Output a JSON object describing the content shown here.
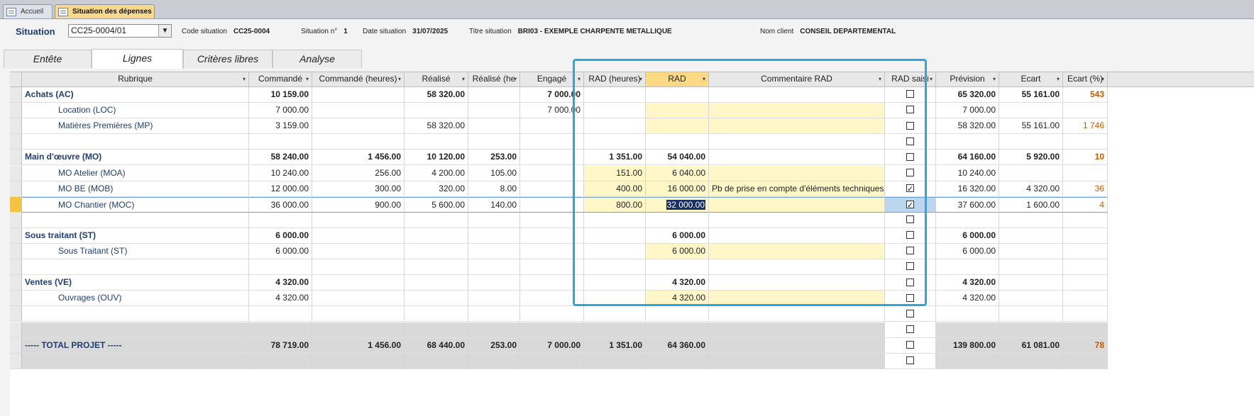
{
  "doc_tabs": [
    {
      "label": "Accueil",
      "active": false
    },
    {
      "label": "Situation des dépenses",
      "active": true
    }
  ],
  "header": {
    "situation_label": "Situation",
    "situation_value": "CC25-0004/01",
    "code_label": "Code situation",
    "code_value": "CC25-0004",
    "num_label": "Situation n°",
    "num_value": "1",
    "date_label": "Date situation",
    "date_value": "31/07/2025",
    "titre_label": "Titre situation",
    "titre_value": "BRI03 - EXEMPLE CHARPENTE METALLIQUE",
    "client_label": "Nom client",
    "client_value": "CONSEIL DEPARTEMENTAL"
  },
  "tabs": [
    {
      "label": "Entête",
      "active": false
    },
    {
      "label": "Lignes",
      "active": true
    },
    {
      "label": "Critères libres",
      "active": false
    },
    {
      "label": "Analyse",
      "active": false
    }
  ],
  "columns": [
    "Rubrique",
    "Commandé",
    "Commandé (heures)",
    "Réalisé",
    "Réalisé (he",
    "Engagé",
    "RAD (heures)",
    "RAD",
    "Commentaire RAD",
    "RAD saisi",
    "Prévision",
    "Ecart",
    "Ecart (%)"
  ],
  "rows": [
    {
      "type": "cat",
      "rubrique": "Achats (AC)",
      "commande": "10 159.00",
      "commande_h": "",
      "realise": "58 320.00",
      "realise_h": "",
      "engage": "7 000.00",
      "rad_h": "",
      "rad": "",
      "commentaire": "",
      "rad_saisi": false,
      "prevision": "65 320.00",
      "ecart": "55 161.00",
      "ecart_pct": "543"
    },
    {
      "type": "sub",
      "rubrique": "Location (LOC)",
      "commande": "7 000.00",
      "commande_h": "",
      "realise": "",
      "realise_h": "",
      "engage": "7 000.00",
      "rad_h": "",
      "rad": "",
      "commentaire": "",
      "rad_saisi": false,
      "prevision": "7 000.00",
      "ecart": "",
      "ecart_pct": ""
    },
    {
      "type": "sub",
      "rubrique": "Matières Premières (MP)",
      "commande": "3 159.00",
      "commande_h": "",
      "realise": "58 320.00",
      "realise_h": "",
      "engage": "",
      "rad_h": "",
      "rad": "",
      "commentaire": "",
      "rad_saisi": false,
      "prevision": "58 320.00",
      "ecart": "55 161.00",
      "ecart_pct": "1 746"
    },
    {
      "type": "blank",
      "rubrique": "",
      "commande": "",
      "commande_h": "",
      "realise": "",
      "realise_h": "",
      "engage": "",
      "rad_h": "",
      "rad": "",
      "commentaire": "",
      "rad_saisi": false,
      "prevision": "",
      "ecart": "",
      "ecart_pct": ""
    },
    {
      "type": "cat",
      "rubrique": "Main d'œuvre (MO)",
      "commande": "58 240.00",
      "commande_h": "1 456.00",
      "realise": "10 120.00",
      "realise_h": "253.00",
      "engage": "",
      "rad_h": "1 351.00",
      "rad": "54 040.00",
      "commentaire": "",
      "rad_saisi": false,
      "prevision": "64 160.00",
      "ecart": "5 920.00",
      "ecart_pct": "10"
    },
    {
      "type": "sub",
      "rubrique": "MO Atelier (MOA)",
      "commande": "10 240.00",
      "commande_h": "256.00",
      "realise": "4 200.00",
      "realise_h": "105.00",
      "engage": "",
      "rad_h": "151.00",
      "rad": "6 040.00",
      "commentaire": "",
      "rad_saisi": false,
      "prevision": "10 240.00",
      "ecart": "",
      "ecart_pct": ""
    },
    {
      "type": "sub",
      "rubrique": "MO BE (MOB)",
      "commande": "12 000.00",
      "commande_h": "300.00",
      "realise": "320.00",
      "realise_h": "8.00",
      "engage": "",
      "rad_h": "400.00",
      "rad": "16 000.00",
      "commentaire": "Pb de prise en compte d'éléments techniques",
      "rad_saisi": true,
      "prevision": "16 320.00",
      "ecart": "4 320.00",
      "ecart_pct": "36"
    },
    {
      "type": "sub",
      "current": true,
      "rubrique": "MO Chantier (MOC)",
      "commande": "36 000.00",
      "commande_h": "900.00",
      "realise": "5 600.00",
      "realise_h": "140.00",
      "engage": "",
      "rad_h": "800.00",
      "rad": "32 000.00",
      "commentaire": "",
      "rad_saisi": true,
      "prevision": "37 600.00",
      "ecart": "1 600.00",
      "ecart_pct": "4"
    },
    {
      "type": "blank",
      "rubrique": "",
      "commande": "",
      "commande_h": "",
      "realise": "",
      "realise_h": "",
      "engage": "",
      "rad_h": "",
      "rad": "",
      "commentaire": "",
      "rad_saisi": false,
      "prevision": "",
      "ecart": "",
      "ecart_pct": ""
    },
    {
      "type": "cat",
      "rubrique": "Sous traitant (ST)",
      "commande": "6 000.00",
      "commande_h": "",
      "realise": "",
      "realise_h": "",
      "engage": "",
      "rad_h": "",
      "rad": "6 000.00",
      "commentaire": "",
      "rad_saisi": false,
      "prevision": "6 000.00",
      "ecart": "",
      "ecart_pct": ""
    },
    {
      "type": "sub",
      "rubrique": "Sous Traitant (ST)",
      "commande": "6 000.00",
      "commande_h": "",
      "realise": "",
      "realise_h": "",
      "engage": "",
      "rad_h": "",
      "rad": "6 000.00",
      "commentaire": "",
      "rad_saisi": false,
      "prevision": "6 000.00",
      "ecart": "",
      "ecart_pct": ""
    },
    {
      "type": "blank",
      "rubrique": "",
      "commande": "",
      "commande_h": "",
      "realise": "",
      "realise_h": "",
      "engage": "",
      "rad_h": "",
      "rad": "",
      "commentaire": "",
      "rad_saisi": false,
      "prevision": "",
      "ecart": "",
      "ecart_pct": ""
    },
    {
      "type": "cat",
      "rubrique": "Ventes (VE)",
      "commande": "4 320.00",
      "commande_h": "",
      "realise": "",
      "realise_h": "",
      "engage": "",
      "rad_h": "",
      "rad": "4 320.00",
      "commentaire": "",
      "rad_saisi": false,
      "prevision": "4 320.00",
      "ecart": "",
      "ecart_pct": ""
    },
    {
      "type": "sub",
      "rubrique": "Ouvrages (OUV)",
      "commande": "4 320.00",
      "commande_h": "",
      "realise": "",
      "realise_h": "",
      "engage": "",
      "rad_h": "",
      "rad": "4 320.00",
      "commentaire": "",
      "rad_saisi": false,
      "prevision": "4 320.00",
      "ecart": "",
      "ecart_pct": ""
    },
    {
      "type": "blank",
      "rubrique": "",
      "commande": "",
      "commande_h": "",
      "realise": "",
      "realise_h": "",
      "engage": "",
      "rad_h": "",
      "rad": "",
      "commentaire": "",
      "rad_saisi": false,
      "prevision": "",
      "ecart": "",
      "ecart_pct": ""
    },
    {
      "type": "gray",
      "rubrique": "",
      "commande": "",
      "commande_h": "",
      "realise": "",
      "realise_h": "",
      "engage": "",
      "rad_h": "",
      "rad": "",
      "commentaire": "",
      "rad_saisi": false,
      "prevision": "",
      "ecart": "",
      "ecart_pct": ""
    },
    {
      "type": "total",
      "rubrique": "----- TOTAL PROJET -----",
      "commande": "78 719.00",
      "commande_h": "1 456.00",
      "realise": "68 440.00",
      "realise_h": "253.00",
      "engage": "7 000.00",
      "rad_h": "1 351.00",
      "rad": "64 360.00",
      "commentaire": "",
      "rad_saisi": false,
      "prevision": "139 800.00",
      "ecart": "61 081.00",
      "ecart_pct": "78"
    },
    {
      "type": "gray",
      "rubrique": "",
      "commande": "",
      "commande_h": "",
      "realise": "",
      "realise_h": "",
      "engage": "",
      "rad_h": "",
      "rad": "",
      "commentaire": "",
      "rad_saisi": false,
      "prevision": "",
      "ecart": "",
      "ecart_pct": ""
    }
  ],
  "colors": {
    "highlight_frame": "#2aa6dc",
    "rad_header": "#fbd985",
    "editable_cell": "#fff7c8",
    "current_row": "#f5c342",
    "negative_pct": "#c65a00"
  }
}
